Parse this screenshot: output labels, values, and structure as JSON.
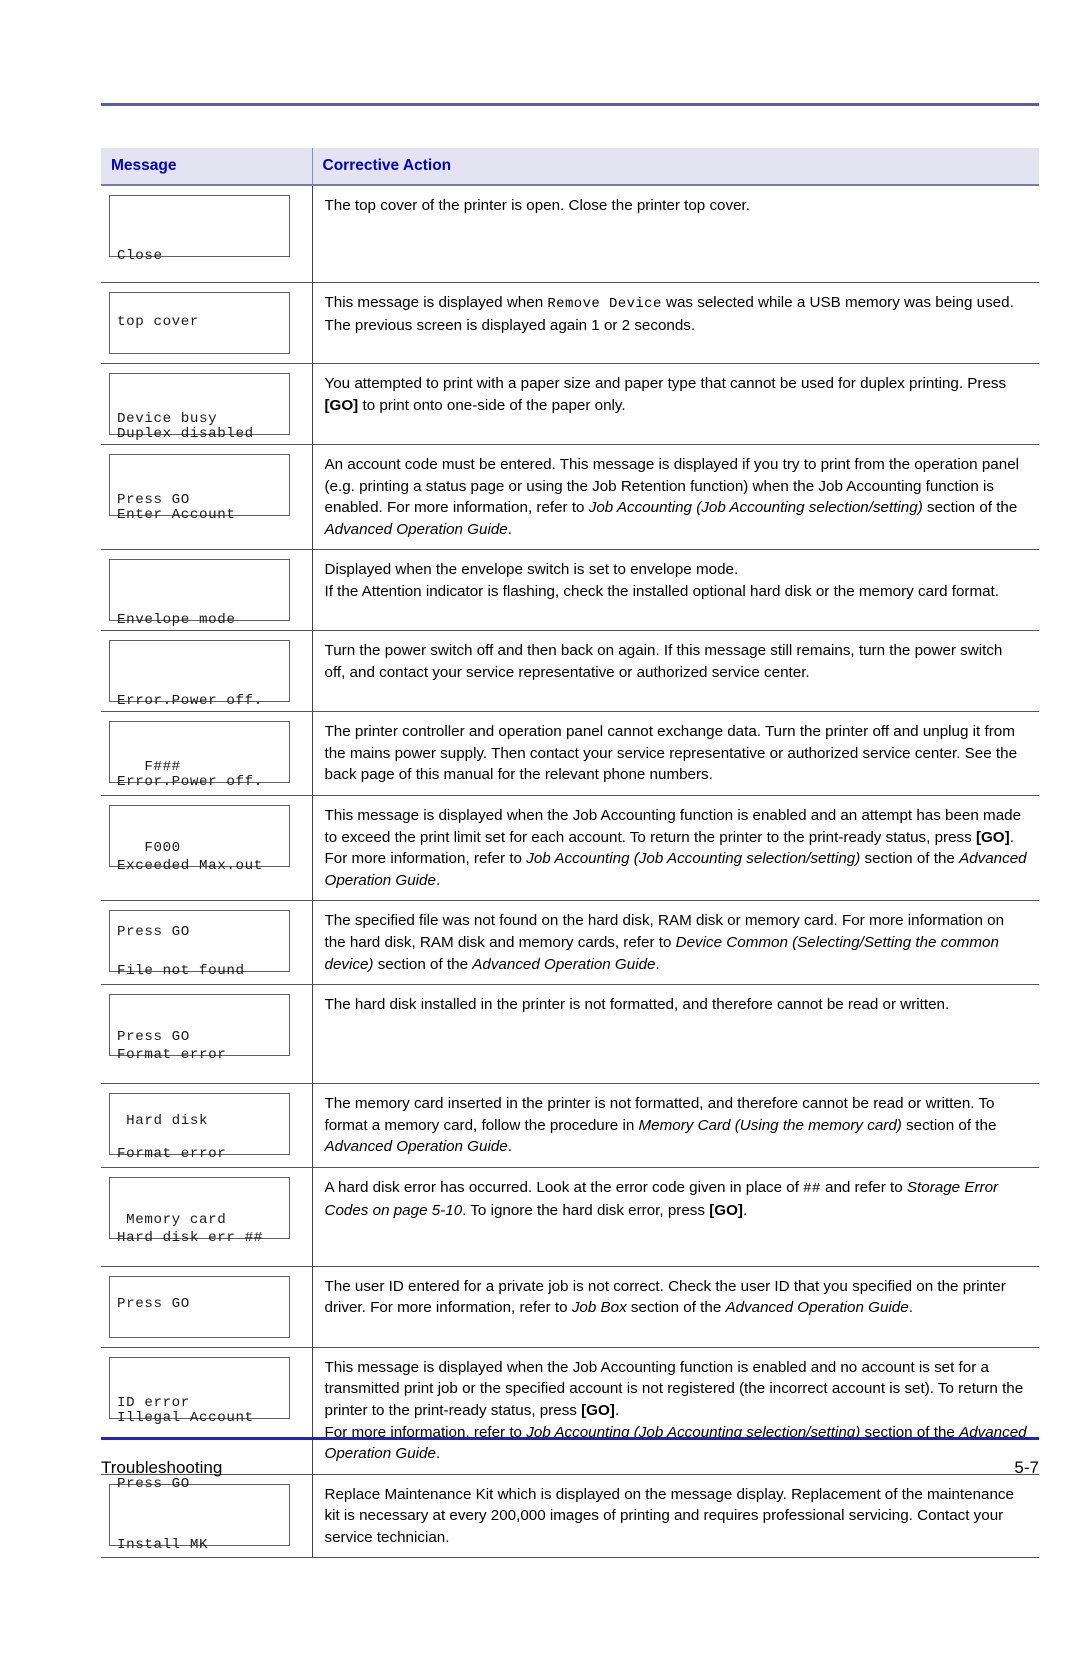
{
  "document": {
    "footer_section": "Troubleshooting",
    "footer_page": "5-7"
  },
  "table": {
    "headers": {
      "message": "Message",
      "corrective_action": "Corrective Action"
    },
    "rows": [
      {
        "lcd_line1": "Close",
        "lcd_line2": "top cover",
        "action_text": "The top cover of the printer is open. Close the printer top cover."
      },
      {
        "lcd_line1": "",
        "lcd_line2": "Device busy",
        "action_p1_a": "This message is displayed when ",
        "action_p1_mono": "Remove Device",
        "action_p1_b": " was selected while a USB memory was being used.",
        "action_p2": "The previous screen is displayed again 1 or 2 seconds."
      },
      {
        "lcd_line1": "Duplex disabled",
        "lcd_line2": "Press GO",
        "action_a": "You attempted to print with a paper size and paper type that cannot be used for duplex printing. Press ",
        "action_bold": "[GO]",
        "action_b": " to print onto one-side of the paper only."
      },
      {
        "lcd_line1": "Enter Account",
        "lcd_line2": "",
        "action_a": "An account code must be entered. This message is displayed if you try to print from the operation panel (e.g. printing a status page or using the Job Retention function) when the Job Accounting function is enabled. For more information, refer to ",
        "action_ital1": "Job Accounting (Job Accounting selection/setting)",
        "action_b": " section of the ",
        "action_ital2": "Advanced Operation Guide",
        "action_c": "."
      },
      {
        "lcd_line1": "Envelope mode",
        "lcd_line2": "",
        "action_p1": "Displayed when the envelope switch is set to envelope mode.",
        "action_p2": "If the Attention indicator is flashing, check the installed optional hard disk or the memory card format."
      },
      {
        "lcd_line1": "Error.Power off.",
        "lcd_line2": "   F###",
        "action_text": "Turn the power switch off and then back on again. If this message still remains, turn the power switch off, and contact your service representative or authorized service center."
      },
      {
        "lcd_line1": "Error.Power off.",
        "lcd_line2": "   F000",
        "action_text": "The printer controller and operation panel cannot exchange data. Turn the printer off and unplug it from the mains power supply. Then contact your service representative or authorized service center. See the back page of this manual for the relevant phone numbers."
      },
      {
        "lcd_line1": "Exceeded Max.out",
        "lcd_line2": "Press GO",
        "action_a": "This message is displayed when the Job Accounting function is enabled and an attempt has been made to exceed the print limit set for each account. To return the printer to the print-ready status, press ",
        "action_bold": "[GO]",
        "action_b": ".",
        "action_p2_a": "For more information, refer to ",
        "action_p2_ital1": "Job Accounting (Job Accounting selection/setting)",
        "action_p2_b": " section of the ",
        "action_p2_ital2": "Advanced Operation Guide",
        "action_p2_c": "."
      },
      {
        "lcd_line1": "File not found",
        "lcd_line2": "Press GO",
        "action_a": "The specified file was not found on the hard disk, RAM disk or memory card. For more information on the hard disk, RAM disk and memory cards, refer to ",
        "action_ital1": "Device Common (Selecting/Setting the common device)",
        "action_b": " section of the ",
        "action_ital2": "Advanced Operation Guide",
        "action_c": "."
      },
      {
        "lcd_line1": "Format error",
        "lcd_line2": " Hard disk",
        "action_text": "The hard disk installed in the printer is not formatted, and therefore cannot be read or written."
      },
      {
        "lcd_line1": "Format error",
        "lcd_line2": " Memory card",
        "action_a": "The memory card inserted in the printer is not formatted, and therefore cannot be read or written. To format a memory card, follow the procedure in ",
        "action_ital1": "Memory Card (Using the memory card)",
        "action_b": " section of the ",
        "action_ital2": "Advanced Operation Guide",
        "action_c": "."
      },
      {
        "lcd_line1": "Hard disk err ##",
        "lcd_line2": "Press GO",
        "action_a": "A hard disk error has occurred. Look at the error code given in place of ",
        "action_mono": "##",
        "action_b": " and refer to ",
        "action_ital1": "Storage Error Codes on page 5-10",
        "action_c": ". To ignore the hard disk error, press ",
        "action_bold": "[GO]",
        "action_d": "."
      },
      {
        "lcd_line1": "",
        "lcd_line2": "ID error",
        "action_a": "The user ID entered for a private job is not correct. Check the user ID that you specified on the printer driver. For more information, refer to ",
        "action_ital1": "Job Box",
        "action_b": " section of the ",
        "action_ital2": "Advanced Operation Guide",
        "action_c": "."
      },
      {
        "lcd_line1": "Illegal Account",
        "lcd_line2": "Press GO",
        "action_a": "This message is displayed when the Job Accounting function is enabled and no account is set for a transmitted print job or the specified account is not registered (the incorrect account is set). To return the printer to the print-ready status, press ",
        "action_bold": "[GO]",
        "action_b": ".",
        "action_p2_a": "For more information, refer to ",
        "action_p2_ital1": "Job Accounting (Job Accounting selection/setting)",
        "action_p2_b": " section of the ",
        "action_p2_ital2": "Advanced Operation Guide",
        "action_p2_c": "."
      },
      {
        "lcd_line1": "Install MK",
        "lcd_line2": "",
        "action_text": "Replace Maintenance Kit which is displayed on the message display. Replacement of the maintenance kit is necessary at every 200,000 images of printing and requires professional servicing. Contact your service technician."
      }
    ]
  }
}
